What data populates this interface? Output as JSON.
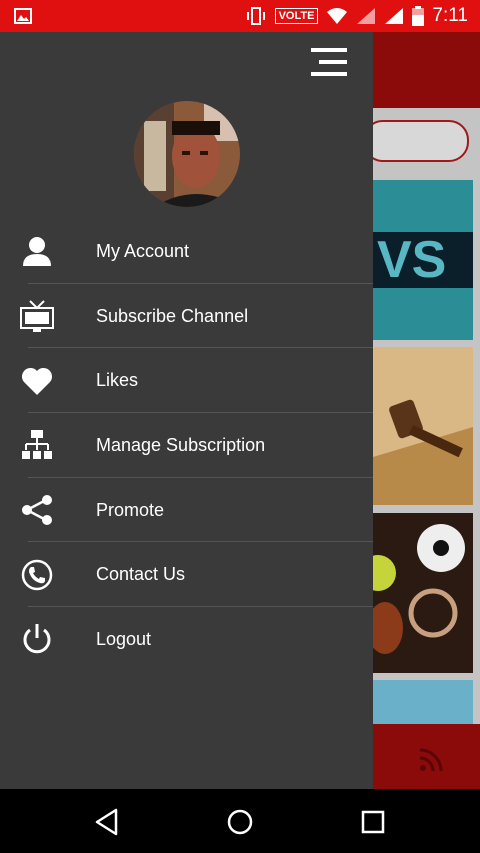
{
  "status_bar": {
    "volte_label": "VOLTE",
    "time": "7:11",
    "icons": [
      "image-icon",
      "vibrate-icon",
      "wifi-icon",
      "signal-icon",
      "battery-icon"
    ]
  },
  "drawer": {
    "menu_icon": "menu-icon",
    "items": [
      {
        "label": "My Account",
        "icon": "user-icon"
      },
      {
        "label": "Subscribe Channel",
        "icon": "tv-icon"
      },
      {
        "label": "Likes",
        "icon": "heart-icon"
      },
      {
        "label": "Manage Subscription",
        "icon": "sitemap-icon"
      },
      {
        "label": "Promote",
        "icon": "share-icon"
      },
      {
        "label": "Contact Us",
        "icon": "phone-icon"
      },
      {
        "label": "Logout",
        "icon": "power-icon"
      }
    ]
  },
  "background_app": {
    "banner_text": "VS"
  },
  "nav_bar": {
    "icons": [
      "back-icon",
      "home-icon",
      "recents-icon"
    ]
  },
  "colors": {
    "status_bar": "#e01010",
    "drawer_bg": "#3a3a3a",
    "app_header": "#8b0a0a",
    "text": "#ffffff"
  }
}
